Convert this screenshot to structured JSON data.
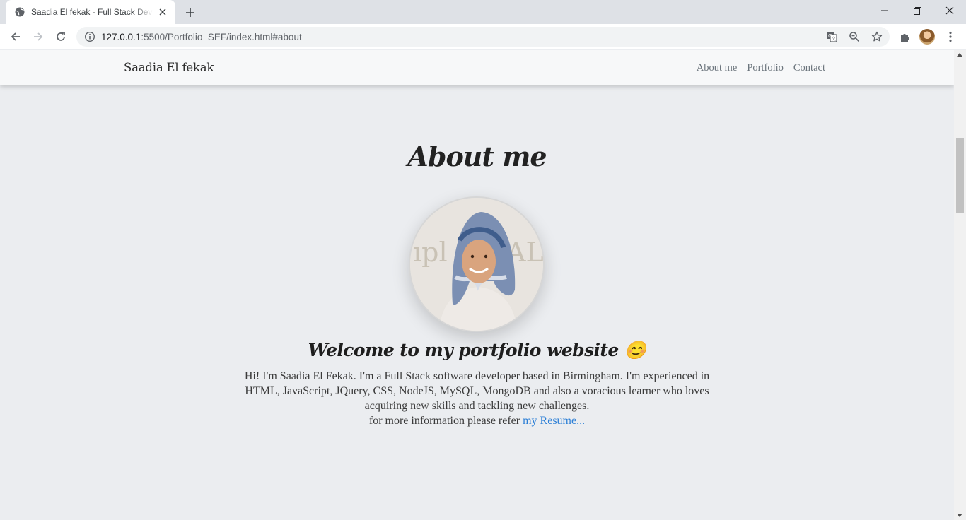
{
  "browser": {
    "tab_title": "Saadia El fekak - Full Stack Developer",
    "url_host": "127.0.0.1",
    "url_rest": ":5500/Portfolio_SEF/index.html#about"
  },
  "site": {
    "brand": "Saadia El fekak",
    "nav": [
      "About me",
      "Portfolio",
      "Contact"
    ]
  },
  "about": {
    "title": "About me",
    "welcome": "Welcome to my portfolio website 😊",
    "bio_line1": "Hi! I'm Saadia El Fekak. I'm a Full Stack software developer based in Birmingham. I'm experienced in HTML, JavaScript, JQuery, CSS, NodeJS, MySQL, MongoDB and also a voracious learner who loves acquiring new skills and tackling new challenges.",
    "bio_line2": "for more information please refer ",
    "resume_link": "my Resume..."
  },
  "colors": {
    "link": "#2c7fd6",
    "page_bg": "#ebedf0"
  }
}
